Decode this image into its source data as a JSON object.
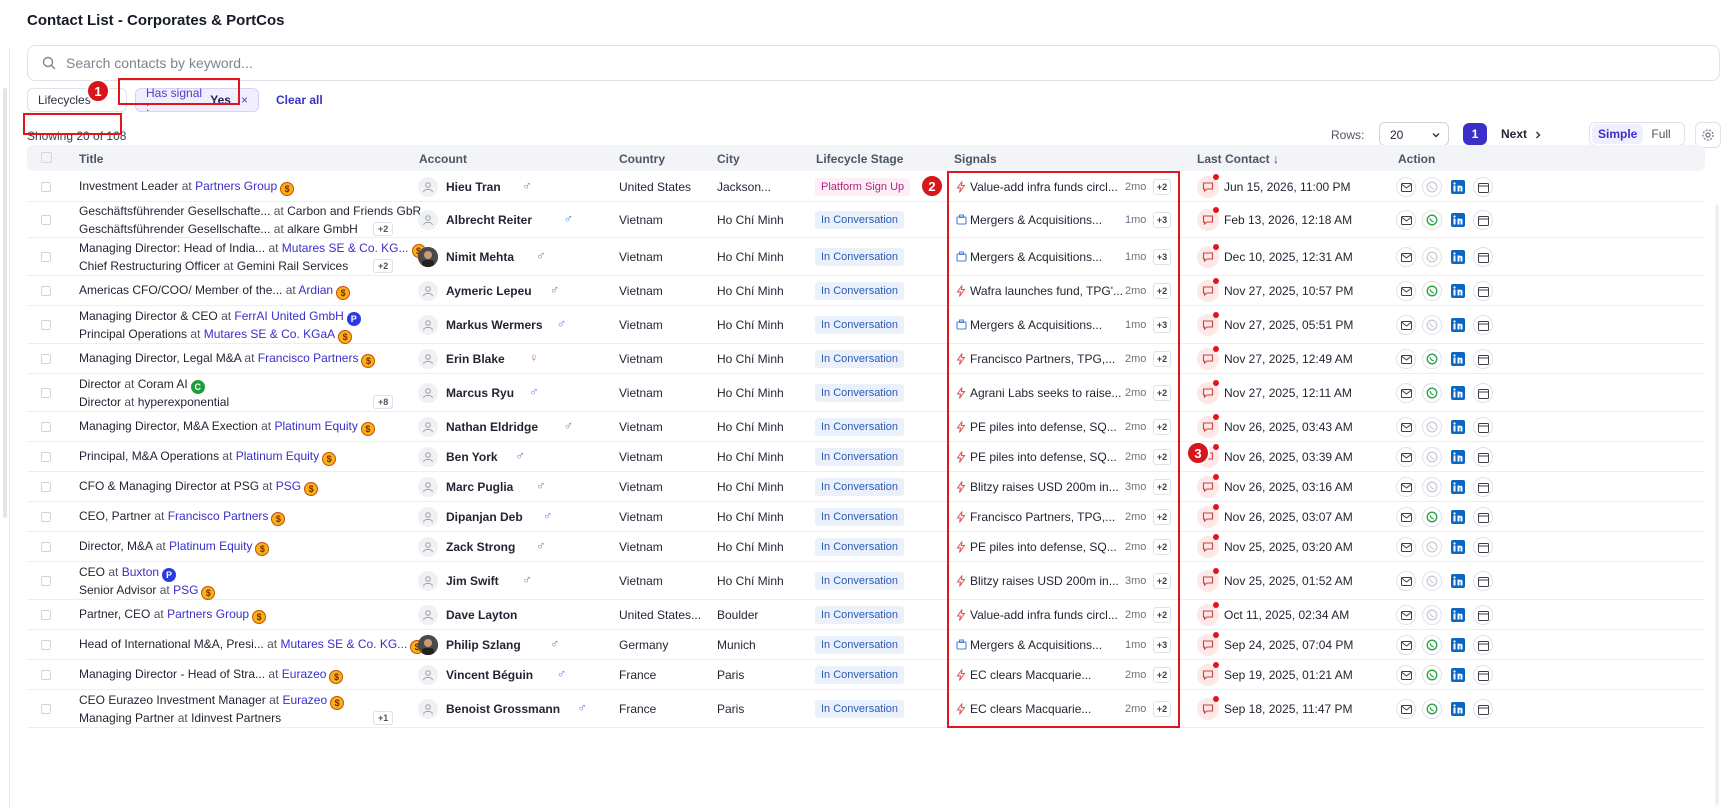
{
  "page": {
    "title": "Contact List - Corporates & PortCos"
  },
  "search": {
    "placeholder": "Search contacts by keyword..."
  },
  "filters": {
    "lifecycles_label": "Lifecycles",
    "signal_label": "Has signal :",
    "signal_value": "Yes",
    "remove_symbol": "×",
    "clear_all": "Clear all"
  },
  "annotations": [
    "1",
    "2",
    "3"
  ],
  "summary": {
    "showing": "Showing 20 of 108"
  },
  "pagination": {
    "rows_label": "Rows:",
    "rows_value": "20",
    "current_page": "1",
    "next_label": "Next",
    "view_simple": "Simple",
    "view_full": "Full"
  },
  "columns": {
    "title": "Title",
    "account": "Account",
    "country": "Country",
    "city": "City",
    "lifecycle": "Lifecycle Stage",
    "signals": "Signals",
    "last_contact": "Last Contact",
    "last_contact_sort": "↓",
    "action": "Action"
  },
  "colors": {
    "accent": "#3a2fc9",
    "annotation_red": "#e0161b",
    "whatsapp_active": "#25a244",
    "linkedin": "#0a66c2"
  },
  "rows": [
    {
      "title1": {
        "role": "Investment Leader",
        "at": " at ",
        "company": "Partners Group",
        "badge": "$",
        "badge_type": "s"
      },
      "title2": null,
      "more": "",
      "name": "Hieu Tran",
      "gender": "♂",
      "photo": false,
      "country": "United States",
      "city": "Jackson...",
      "stage": "Platform Sign Up",
      "signal_icon": "bolt",
      "signal": "Value-add infra funds circl...",
      "age": "2mo",
      "sig_more": "+2",
      "last": "Jun 15, 2026, 11:00 PM",
      "whatsapp": false
    },
    {
      "title1": {
        "role": "Geschäftsführender Gesellschafte...",
        "at": " at ",
        "company": "Carbon and Friends GbR",
        "badge": "",
        "company_plain": true
      },
      "title2": {
        "role": "Geschäftsführender Gesellschafte...",
        "at": " at ",
        "company": "alkare GmbH",
        "badge": "",
        "company_plain": true
      },
      "more": "+2",
      "name": "Albrecht Reiter",
      "gender": "♂",
      "photo": false,
      "country": "Vietnam",
      "city": "Ho Chí Minh",
      "stage": "In Conversation",
      "signal_icon": "bag",
      "signal": "Mergers & Acquisitions...",
      "age": "1mo",
      "sig_more": "+3",
      "last": "Feb 13, 2026, 12:18 AM",
      "whatsapp": true
    },
    {
      "title1": {
        "role": "Managing Director: Head of India...",
        "at": " at ",
        "company": "Mutares SE & Co. KG...",
        "badge": "$",
        "badge_type": "s"
      },
      "title2": {
        "role": "Chief Restructuring Officer",
        "at": " at ",
        "company": "Gemini Rail Services",
        "badge": "",
        "company_plain": true
      },
      "more": "+2",
      "name": "Nimit Mehta",
      "gender": "♂",
      "photo": true,
      "country": "Vietnam",
      "city": "Ho Chí Minh",
      "stage": "In Conversation",
      "signal_icon": "bag",
      "signal": "Mergers & Acquisitions...",
      "age": "1mo",
      "sig_more": "+3",
      "last": "Dec 10, 2025, 12:31 AM",
      "whatsapp": false
    },
    {
      "title1": {
        "role": "Americas CFO/COO/ Member of the...",
        "at": " at ",
        "company": "Ardian",
        "badge": "$",
        "badge_type": "s"
      },
      "title2": null,
      "more": "",
      "name": "Aymeric Lepeu",
      "gender": "♂",
      "photo": false,
      "country": "Vietnam",
      "city": "Ho Chí Minh",
      "stage": "In Conversation",
      "signal_icon": "bolt",
      "signal": "Wafra launches fund, TPG'...",
      "age": "2mo",
      "sig_more": "+2",
      "last": "Nov 27, 2025, 10:57 PM",
      "whatsapp": true
    },
    {
      "title1": {
        "role": "Managing Director & CEO",
        "at": " at ",
        "company": "FerrAI United GmbH",
        "badge": "P",
        "badge_type": "p"
      },
      "title2": {
        "role": "Principal Operations",
        "at": " at ",
        "company": "Mutares SE & Co. KGaA",
        "badge": "$",
        "badge_type": "s"
      },
      "more": "",
      "name": "Markus Wermers",
      "gender": "♂",
      "photo": false,
      "country": "Vietnam",
      "city": "Ho Chí Minh",
      "stage": "In Conversation",
      "signal_icon": "bag",
      "signal": "Mergers & Acquisitions...",
      "age": "1mo",
      "sig_more": "+3",
      "last": "Nov 27, 2025, 05:51 PM",
      "whatsapp": false
    },
    {
      "title1": {
        "role": "Managing Director, Legal M&A",
        "at": " at ",
        "company": "Francisco Partners",
        "badge": "$",
        "badge_type": "s"
      },
      "title2": null,
      "more": "",
      "name": "Erin Blake",
      "gender": "♀",
      "photo": false,
      "country": "Vietnam",
      "city": "Ho Chí Minh",
      "stage": "In Conversation",
      "signal_icon": "bolt",
      "signal": "Francisco Partners, TPG,...",
      "age": "2mo",
      "sig_more": "+2",
      "last": "Nov 27, 2025, 12:49 AM",
      "whatsapp": true
    },
    {
      "title1": {
        "role": "Director",
        "at": " at ",
        "company": "Coram AI",
        "badge": "C",
        "badge_type": "c",
        "company_plain": true
      },
      "title2": {
        "role": "Director",
        "at": " at ",
        "company": "hyperexponential",
        "badge": "",
        "company_plain": true
      },
      "more": "+8",
      "name": "Marcus Ryu",
      "gender": "♂",
      "photo": false,
      "country": "Vietnam",
      "city": "Ho Chí Minh",
      "stage": "In Conversation",
      "signal_icon": "bolt",
      "signal": "Agrani Labs seeks to raise...",
      "age": "2mo",
      "sig_more": "+2",
      "last": "Nov 27, 2025, 12:11 AM",
      "whatsapp": true
    },
    {
      "title1": {
        "role": "Managing Director, M&A Exection",
        "at": " at ",
        "company": "Platinum Equity",
        "badge": "$",
        "badge_type": "s"
      },
      "title2": null,
      "more": "",
      "name": "Nathan Eldridge",
      "gender": "♂",
      "photo": false,
      "country": "Vietnam",
      "city": "Ho Chí Minh",
      "stage": "In Conversation",
      "signal_icon": "bolt",
      "signal": "PE piles into defense, SQ...",
      "age": "2mo",
      "sig_more": "+2",
      "last": "Nov 26, 2025, 03:43 AM",
      "whatsapp": false
    },
    {
      "title1": {
        "role": "Principal, M&A Operations",
        "at": " at ",
        "company": "Platinum Equity",
        "badge": "$",
        "badge_type": "s"
      },
      "title2": null,
      "more": "",
      "name": "Ben York",
      "gender": "♂",
      "photo": false,
      "country": "Vietnam",
      "city": "Ho Chí Minh",
      "stage": "In Conversation",
      "signal_icon": "bolt",
      "signal": "PE piles into defense, SQ...",
      "age": "2mo",
      "sig_more": "+2",
      "last": "Nov 26, 2025, 03:39 AM",
      "whatsapp": false
    },
    {
      "title1": {
        "role": "CFO & Managing Director at PSG",
        "at": " at ",
        "company": "PSG",
        "badge": "$",
        "badge_type": "s"
      },
      "title2": null,
      "more": "",
      "name": "Marc Puglia",
      "gender": "♂",
      "photo": false,
      "country": "Vietnam",
      "city": "Ho Chí Minh",
      "stage": "In Conversation",
      "signal_icon": "bolt",
      "signal": "Blitzy raises USD 200m in...",
      "age": "3mo",
      "sig_more": "+2",
      "last": "Nov 26, 2025, 03:16 AM",
      "whatsapp": false
    },
    {
      "title1": {
        "role": "CEO, Partner",
        "at": " at ",
        "company": "Francisco Partners",
        "badge": "$",
        "badge_type": "s"
      },
      "title2": null,
      "more": "",
      "name": "Dipanjan Deb",
      "gender": "♂",
      "photo": false,
      "country": "Vietnam",
      "city": "Ho Chí Minh",
      "stage": "In Conversation",
      "signal_icon": "bolt",
      "signal": "Francisco Partners, TPG,...",
      "age": "2mo",
      "sig_more": "+2",
      "last": "Nov 26, 2025, 03:07 AM",
      "whatsapp": true
    },
    {
      "title1": {
        "role": "Director, M&A",
        "at": " at ",
        "company": "Platinum Equity",
        "badge": "$",
        "badge_type": "s"
      },
      "title2": null,
      "more": "",
      "name": "Zack Strong",
      "gender": "♂",
      "photo": false,
      "country": "Vietnam",
      "city": "Ho Chí Minh",
      "stage": "In Conversation",
      "signal_icon": "bolt",
      "signal": "PE piles into defense, SQ...",
      "age": "2mo",
      "sig_more": "+2",
      "last": "Nov 25, 2025, 03:20 AM",
      "whatsapp": false
    },
    {
      "title1": {
        "role": "CEO",
        "at": " at ",
        "company": "Buxton",
        "badge": "P",
        "badge_type": "p"
      },
      "title2": {
        "role": "Senior Advisor",
        "at": " at ",
        "company": "PSG",
        "badge": "$",
        "badge_type": "s"
      },
      "more": "",
      "name": "Jim Swift",
      "gender": "♂",
      "photo": false,
      "country": "Vietnam",
      "city": "Ho Chí Minh",
      "stage": "In Conversation",
      "signal_icon": "bolt",
      "signal": "Blitzy raises USD 200m in...",
      "age": "3mo",
      "sig_more": "+2",
      "last": "Nov 25, 2025, 01:52 AM",
      "whatsapp": false
    },
    {
      "title1": {
        "role": "Partner, CEO",
        "at": " at ",
        "company": "Partners Group",
        "badge": "$",
        "badge_type": "s"
      },
      "title2": null,
      "more": "",
      "name": "Dave Layton",
      "gender": "",
      "photo": false,
      "country": "United States...",
      "city": "Boulder",
      "stage": "In Conversation",
      "signal_icon": "bolt",
      "signal": "Value-add infra funds circl...",
      "age": "2mo",
      "sig_more": "+2",
      "last": "Oct 11, 2025, 02:34 AM",
      "whatsapp": false
    },
    {
      "title1": {
        "role": "Head of International M&A, Presi...",
        "at": " at ",
        "company": "Mutares SE & Co. KG...",
        "badge": "$",
        "badge_type": "s"
      },
      "title2": null,
      "more": "",
      "name": "Philip Szlang",
      "gender": "♂",
      "photo": true,
      "country": "Germany",
      "city": "Munich",
      "stage": "In Conversation",
      "signal_icon": "bag",
      "signal": "Mergers & Acquisitions...",
      "age": "1mo",
      "sig_more": "+3",
      "last": "Sep 24, 2025, 07:04 PM",
      "whatsapp": true
    },
    {
      "title1": {
        "role": "Managing Director - Head of Stra...",
        "at": " at ",
        "company": "Eurazeo",
        "badge": "$",
        "badge_type": "s"
      },
      "title2": null,
      "more": "",
      "name": "Vincent Béguin",
      "gender": "♂",
      "photo": false,
      "country": "France",
      "city": "Paris",
      "stage": "In Conversation",
      "signal_icon": "bolt",
      "signal": "EC clears Macquarie...",
      "age": "2mo",
      "sig_more": "+2",
      "last": "Sep 19, 2025, 01:21 AM",
      "whatsapp": true
    },
    {
      "title1": {
        "role": "CEO Eurazeo Investment Manager",
        "at": " at ",
        "company": "Eurazeo",
        "badge": "$",
        "badge_type": "s"
      },
      "title2": {
        "role": "Managing Partner",
        "at": " at ",
        "company": "Idinvest Partners",
        "badge": "",
        "company_plain": true
      },
      "more": "+1",
      "name": "Benoist Grossmann",
      "gender": "♂",
      "photo": false,
      "country": "France",
      "city": "Paris",
      "stage": "In Conversation",
      "signal_icon": "bolt",
      "signal": "EC clears Macquarie...",
      "age": "2mo",
      "sig_more": "+2",
      "last": "Sep 18, 2025, 11:47 PM",
      "whatsapp": true
    }
  ]
}
